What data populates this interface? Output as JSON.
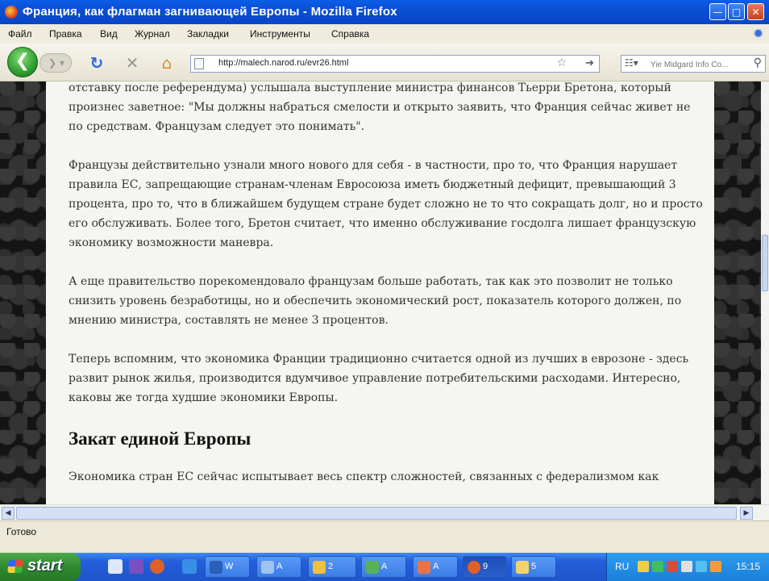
{
  "window": {
    "title": "Франция, как флагман загнивающей Европы - Mozilla Firefox"
  },
  "menu": [
    "Файл",
    "Правка",
    "Вид",
    "Журнал",
    "Закладки",
    "Инструменты",
    "Справка"
  ],
  "nav": {
    "url": "http://malech.narod.ru/evr26.html",
    "search_placeholder": "Yie Midgard Info Co..."
  },
  "content": {
    "paragraphs": [
      "отставку после референдума) услышала выступление министра финансов Тьерри Бретона, который произнес заветное: \"Мы должны набраться смелости и открыто заявить, что Франция сейчас живет не по средствам. Французам следует это понимать\".",
      "Французы действительно узнали много нового для себя - в частности, про то, что Франция нарушает правила ЕС, запрещающие странам-членам Евросоюза иметь бюджетный дефицит, превышающий 3 процента, про то, что в ближайшем будущем стране будет сложно не то что сокращать долг, но и просто его обслуживать. Более того, Бретон считает, что именно обслуживание госдолга лишает французскую экономику возможности маневра.",
      "А еще правительство порекомендовало французам больше работать, так как это позволит не только снизить уровень безработицы, но и обеспечить экономический рост, показатель которого должен, по мнению министра, составлять не менее 3 процентов.",
      "Теперь вспомним, что экономика Франции традиционно считается одной из лучших в еврозоне - здесь развит рынок жилья, производится вдумчивое управление потребительскими расходами. Интересно, каковы же тогда худшие экономики Европы."
    ],
    "heading": "Закат единой Европы",
    "last_paragraph": "Экономика стран ЕС сейчас испытывает весь спектр сложностей, связанных с федерализмом как"
  },
  "status": {
    "text": "Готово"
  },
  "taskbar": {
    "start_label": "start",
    "tasks": [
      "W",
      "A",
      "2",
      "A",
      "A",
      "9",
      "5"
    ],
    "language": "RU",
    "clock": "15:15"
  }
}
